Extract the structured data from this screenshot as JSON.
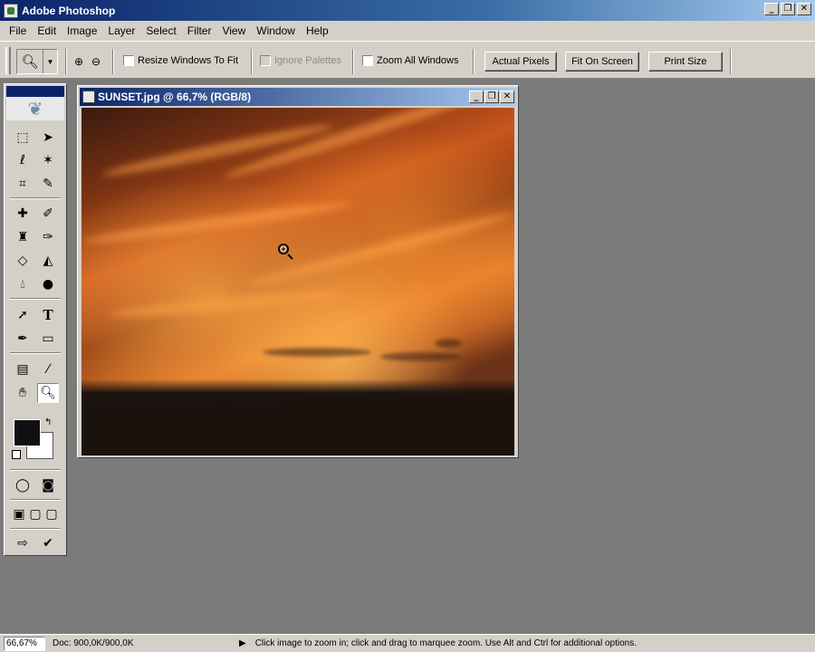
{
  "app": {
    "title": "Adobe Photoshop"
  },
  "window_controls": {
    "minimize": "_",
    "restore": "❐",
    "close": "✕"
  },
  "menu": [
    "File",
    "Edit",
    "Image",
    "Layer",
    "Select",
    "Filter",
    "View",
    "Window",
    "Help"
  ],
  "options": {
    "resize_windows": "Resize Windows To Fit",
    "ignore_palettes": "Ignore Palettes",
    "zoom_all_windows": "Zoom All Windows",
    "actual_pixels": "Actual Pixels",
    "fit_on_screen": "Fit On Screen",
    "print_size": "Print Size"
  },
  "document": {
    "title": "SUNSET.jpg @ 66,7% (RGB/8)"
  },
  "status": {
    "zoom": "66,67%",
    "doc_info": "Doc: 900,0K/900,0K",
    "hint": "Click image to zoom in; click and drag to marquee zoom.  Use Alt and Ctrl for additional options."
  },
  "icons": {
    "zoom_tool": "zoom-tool-icon",
    "marquee": "marquee-icon",
    "move": "move-icon",
    "lasso": "lasso-icon",
    "magic_wand": "magic-wand-icon",
    "crop": "crop-icon",
    "slice": "slice-icon",
    "healing": "healing-brush-icon",
    "brush": "brush-icon",
    "stamp": "clone-stamp-icon",
    "history_brush": "history-brush-icon",
    "eraser": "eraser-icon",
    "paint_bucket": "paint-bucket-icon",
    "blur": "blur-icon",
    "dodge": "dodge-icon",
    "path_select": "path-selection-icon",
    "type": "type-icon",
    "pen": "pen-icon",
    "shape": "rectangle-shape-icon",
    "notes": "notes-icon",
    "eyedropper": "eyedropper-icon",
    "hand": "hand-icon",
    "zoom": "zoom-icon"
  },
  "colors": {
    "foreground": "#111111",
    "background": "#ffffff"
  }
}
